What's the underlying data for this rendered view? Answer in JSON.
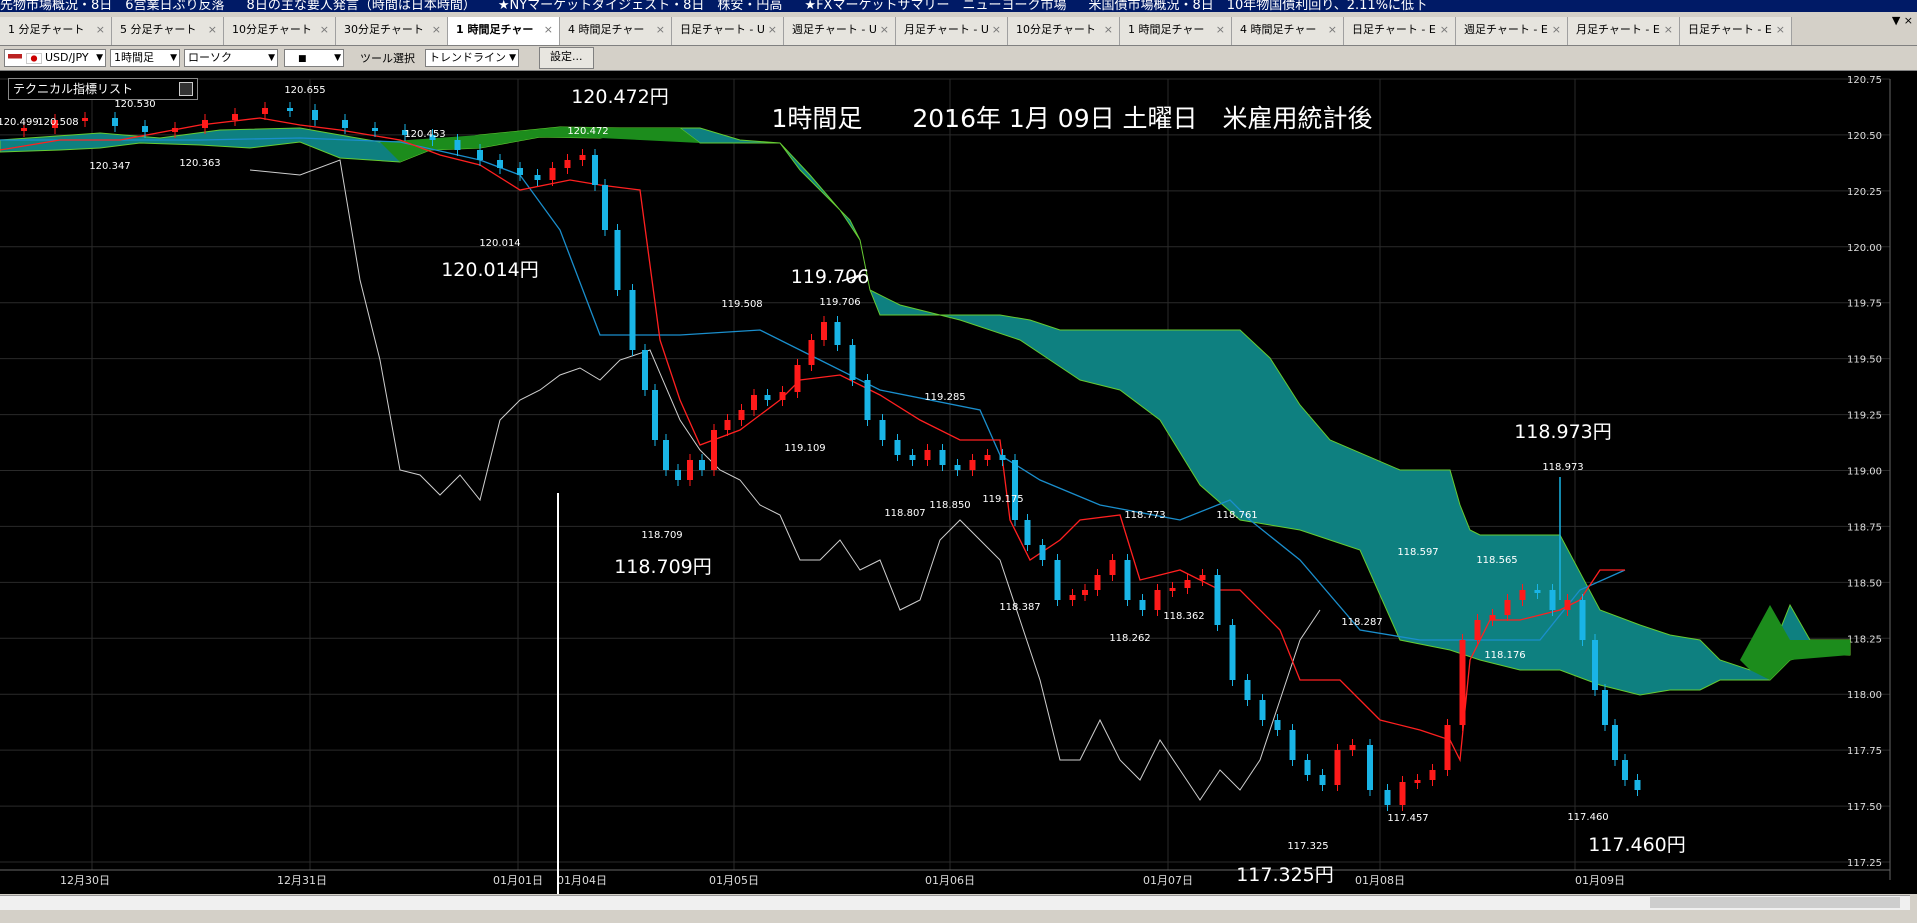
{
  "ticker": [
    "先物市場概況・8日　6営業日ぶり反落",
    "8日の主な要人発言（時間は日本時間）",
    "★NYマーケットダイジェスト・8日　株安・円高",
    "★FXマーケットサマリー　ニューヨーク市場",
    "米国債市場概況・8日　10年物国債利回り、2.11%に低下"
  ],
  "tabs": [
    {
      "label": "1 分足チャート",
      "active": false
    },
    {
      "label": "5 分足チャート",
      "active": false
    },
    {
      "label": "10分足チャート",
      "active": false
    },
    {
      "label": "30分足チャート",
      "active": false
    },
    {
      "label": "1 時間足チャー",
      "active": true
    },
    {
      "label": "4 時間足チャー",
      "active": false
    },
    {
      "label": "日足チャート - U",
      "active": false
    },
    {
      "label": "週足チャート - U",
      "active": false
    },
    {
      "label": "月足チャート - U",
      "active": false
    },
    {
      "label": "10分足チャート",
      "active": false
    },
    {
      "label": "1 時間足チャー",
      "active": false
    },
    {
      "label": "4 時間足チャー",
      "active": false
    },
    {
      "label": "日足チャート - E",
      "active": false
    },
    {
      "label": "週足チャート - E",
      "active": false
    },
    {
      "label": "月足チャート - E",
      "active": false
    },
    {
      "label": "日足チャート - E",
      "active": false
    }
  ],
  "tab_close": "×",
  "tab_controls": "▼ ×",
  "toolbar": {
    "symbol": "USD/JPY",
    "timeframe": "1時間足",
    "chart_type": "ローソク",
    "style": "■",
    "tool_label": "ツール選択",
    "tool": "トレンドライン",
    "settings": "設定..."
  },
  "indicator_list": "テクニカル指標リスト",
  "colors": {
    "bull": "#ff1a1a",
    "bear": "#19b4e6",
    "cloud_green": "#1c8c1c",
    "cloud_teal": "#0e8080",
    "tenkan": "#ff2020",
    "kijun": "#1a8ecc",
    "chikou": "#cfcfcf"
  },
  "chart_data": {
    "type": "candlestick",
    "title": "1時間足　　2016年 1月 09日 土曜日　米雇用統計後",
    "ylim": [
      117.25,
      120.75
    ],
    "yticks": [
      "120.75",
      "120.50",
      "120.25",
      "120.00",
      "119.75",
      "119.50",
      "119.25",
      "119.00",
      "118.75",
      "118.50",
      "118.25",
      "118.00",
      "117.75",
      "117.50",
      "117.25"
    ],
    "xticks": [
      "12月30日",
      "12月31日",
      "01月01日",
      "01月04日",
      "01月05日",
      "01月06日",
      "01月07日",
      "01月08日",
      "01月09日"
    ],
    "price_labels": [
      "120.499",
      "120.508",
      "120.530",
      "120.655",
      "120.347",
      "120.363",
      "120.453",
      "120.472",
      "120.014",
      "119.706",
      "119.508",
      "119.285",
      "119.109",
      "119.175",
      "118.709",
      "118.807",
      "118.850",
      "118.773",
      "118.761",
      "118.387",
      "118.262",
      "118.362",
      "118.287",
      "118.597",
      "118.565",
      "118.176",
      "118.973",
      "117.325",
      "117.457",
      "117.460"
    ],
    "annotations": [
      "120.472円",
      "120.014円",
      "119.706",
      "118.709円",
      "118.973円",
      "117.325円",
      "117.460円"
    ]
  }
}
